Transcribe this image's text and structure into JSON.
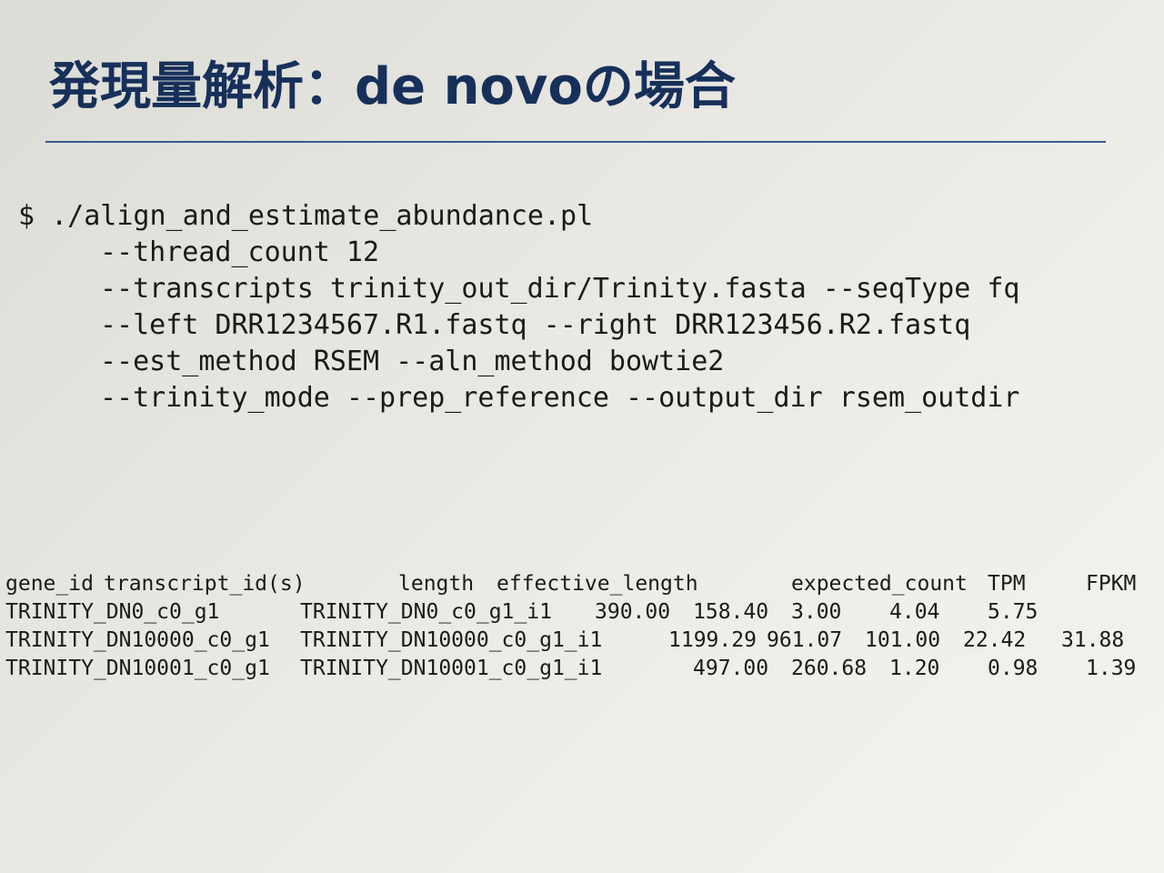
{
  "slide": {
    "title": "発現量解析：de novoの場合"
  },
  "command": {
    "lines": [
      "$ ./align_and_estimate_abundance.pl",
      "--thread_count 12",
      "--transcripts trinity_out_dir/Trinity.fasta --seqType fq",
      "--left DRR1234567.R1.fastq --right DRR123456.R2.fastq",
      "--est_method RSEM --aln_method bowtie2",
      "--trinity_mode --prep_reference --output_dir rsem_outdir"
    ]
  },
  "output": {
    "headers": {
      "gene_id": "gene_id",
      "transcript_ids": "transcript_id(s)",
      "length": "length",
      "effective_length": "effective_length",
      "expected_count": "expected_count",
      "tpm": "TPM",
      "fpkm": "FPKM"
    },
    "rows": [
      {
        "gene_id": "TRINITY_DN0_c0_g1",
        "transcript_ids": "TRINITY_DN0_c0_g1_i1",
        "length": "390.00",
        "effective_length": "158.40",
        "expected_count": "3.00",
        "tpm": "4.04",
        "fpkm": "5.75"
      },
      {
        "gene_id": "TRINITY_DN10000_c0_g1",
        "transcript_ids": "TRINITY_DN10000_c0_g1_i1",
        "length": "1199.29",
        "effective_length": "961.07",
        "expected_count": "101.00",
        "tpm": "22.42",
        "fpkm": "31.88"
      },
      {
        "gene_id": "TRINITY_DN10001_c0_g1",
        "transcript_ids": "TRINITY_DN10001_c0_g1_i1",
        "length": "497.00",
        "effective_length": "260.68",
        "expected_count": "1.20",
        "tpm": "0.98",
        "fpkm": "1.39"
      }
    ]
  }
}
